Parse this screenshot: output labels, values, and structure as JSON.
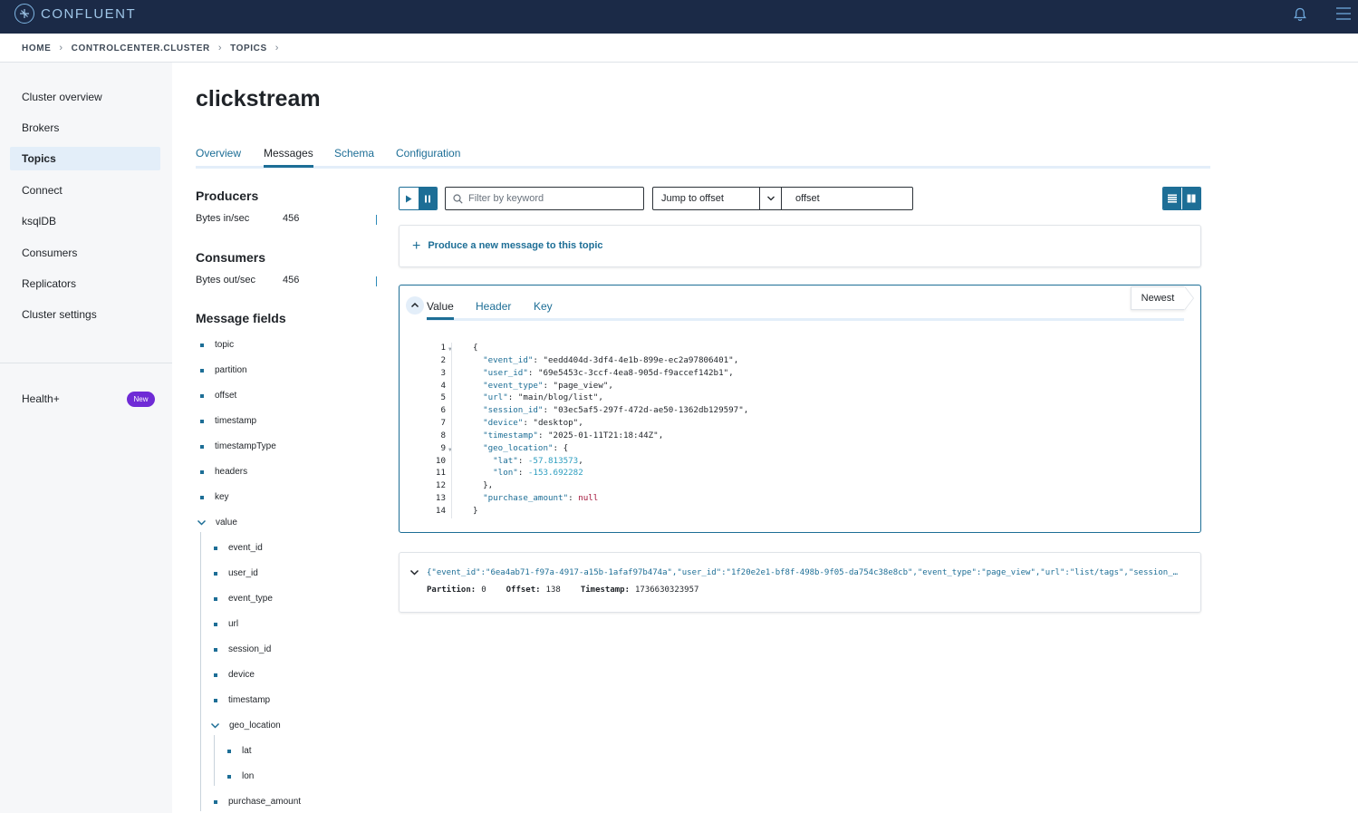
{
  "brand": {
    "name": "CONFLUENT"
  },
  "breadcrumb": [
    "HOME",
    "CONTROLCENTER.CLUSTER",
    "TOPICS"
  ],
  "sidebar": {
    "items": [
      {
        "label": "Cluster overview"
      },
      {
        "label": "Brokers"
      },
      {
        "label": "Topics",
        "active": true
      },
      {
        "label": "Connect"
      },
      {
        "label": "ksqlDB"
      },
      {
        "label": "Consumers"
      },
      {
        "label": "Replicators"
      },
      {
        "label": "Cluster settings"
      }
    ],
    "health_label": "Health+",
    "health_badge": "New"
  },
  "page": {
    "title": "clickstream",
    "tabs": [
      {
        "label": "Overview"
      },
      {
        "label": "Messages",
        "active": true
      },
      {
        "label": "Schema"
      },
      {
        "label": "Configuration"
      }
    ]
  },
  "stats": {
    "producers_title": "Producers",
    "producers_label": "Bytes in/sec",
    "producers_value": "456",
    "consumers_title": "Consumers",
    "consumers_label": "Bytes out/sec",
    "consumers_value": "456"
  },
  "message_fields": {
    "title": "Message fields",
    "fields": [
      "topic",
      "partition",
      "offset",
      "timestamp",
      "timestampType",
      "headers",
      "key"
    ],
    "value_label": "value",
    "value_children": [
      "event_id",
      "user_id",
      "event_type",
      "url",
      "session_id",
      "device",
      "timestamp"
    ],
    "geo_label": "geo_location",
    "geo_children": [
      "lat",
      "lon"
    ],
    "last_field": "purchase_amount"
  },
  "toolbar": {
    "filter_placeholder": "Filter by keyword",
    "jump_label": "Jump to offset",
    "offset_value": "offset"
  },
  "produce": {
    "label": "Produce a new message to this topic"
  },
  "message_open": {
    "tabs": [
      {
        "label": "Value",
        "active": true
      },
      {
        "label": "Header"
      },
      {
        "label": "Key"
      }
    ],
    "newest_label": "Newest",
    "json": {
      "open": "{",
      "event_id": "\"eedd404d-3df4-4e1b-899e-ec2a97806401\"",
      "user_id": "\"69e5453c-3ccf-4ea8-905d-f9accef142b1\"",
      "event_type": "\"page_view\"",
      "url": "\"main/blog/list\"",
      "session_id": "\"03ec5af5-297f-472d-ae50-1362db129597\"",
      "device": "\"desktop\"",
      "timestamp": "\"2025-01-11T21:18:44Z\"",
      "lat": "-57.813573",
      "lon": "-153.692282",
      "purchase_amount": "null",
      "close": "}"
    }
  },
  "message_closed": {
    "preview": "{\"event_id\":\"6ea4ab71-f97a-4917-a15b-1afaf97b474a\",\"user_id\":\"1f20e2e1-bf8f-498b-9f05-da754c38e8cb\",\"event_type\":\"page_view\",\"url\":\"list/tags\",\"session_id\":\"...\"}",
    "partition_label": "Partition:",
    "partition_value": "0",
    "offset_label": "Offset:",
    "offset_value": "138",
    "timestamp_label": "Timestamp:",
    "timestamp_value": "1736630323957"
  },
  "colors": {
    "accent": "#1d6e96",
    "topbar": "#1b2a47",
    "badge": "#6f2bd6"
  }
}
